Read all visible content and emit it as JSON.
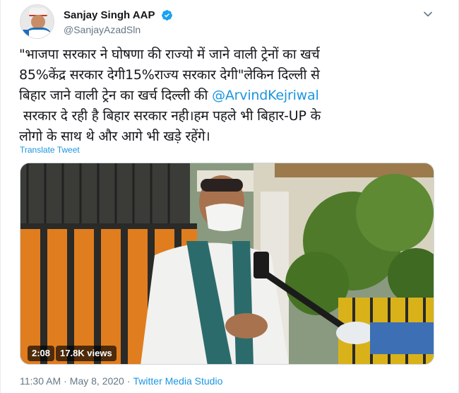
{
  "user": {
    "display_name": "Sanjay Singh AAP",
    "handle": "@SanjayAzadSln",
    "verified_icon": "verified-badge-icon",
    "avatar_icon": "avatar"
  },
  "tweet": {
    "text_line1": "\"भाजपा सरकार ने घोषणा की राज्यो में जाने वाली ट्रेनों का खर्च",
    "text_line2": "85%केंद्र सरकार देगी15%राज्य सरकार देगी\"लेकिन दिल्ली से",
    "text_line3_pre": "बिहार जाने वाली ट्रेन का खर्च दिल्ली की ",
    "mention": "@ArvindKejriwal",
    "text_line4": " सरकार दे रही है बिहार सरकार नही।हम पहले भी बिहार-UP के",
    "text_line5": "लोगो के साथ थे और आगे भी खड़े रहेंगे।",
    "translate_label": "Translate Tweet"
  },
  "video": {
    "duration": "2:08",
    "views": "17.8K views"
  },
  "footer": {
    "time": "11:30 AM",
    "separator": "·",
    "date": "May 8, 2020",
    "separator2": "·",
    "source": "Twitter Media Studio"
  },
  "colors": {
    "link": "#1b95e0",
    "text": "#14171a",
    "muted": "#657786",
    "verified": "#1da1f2"
  }
}
